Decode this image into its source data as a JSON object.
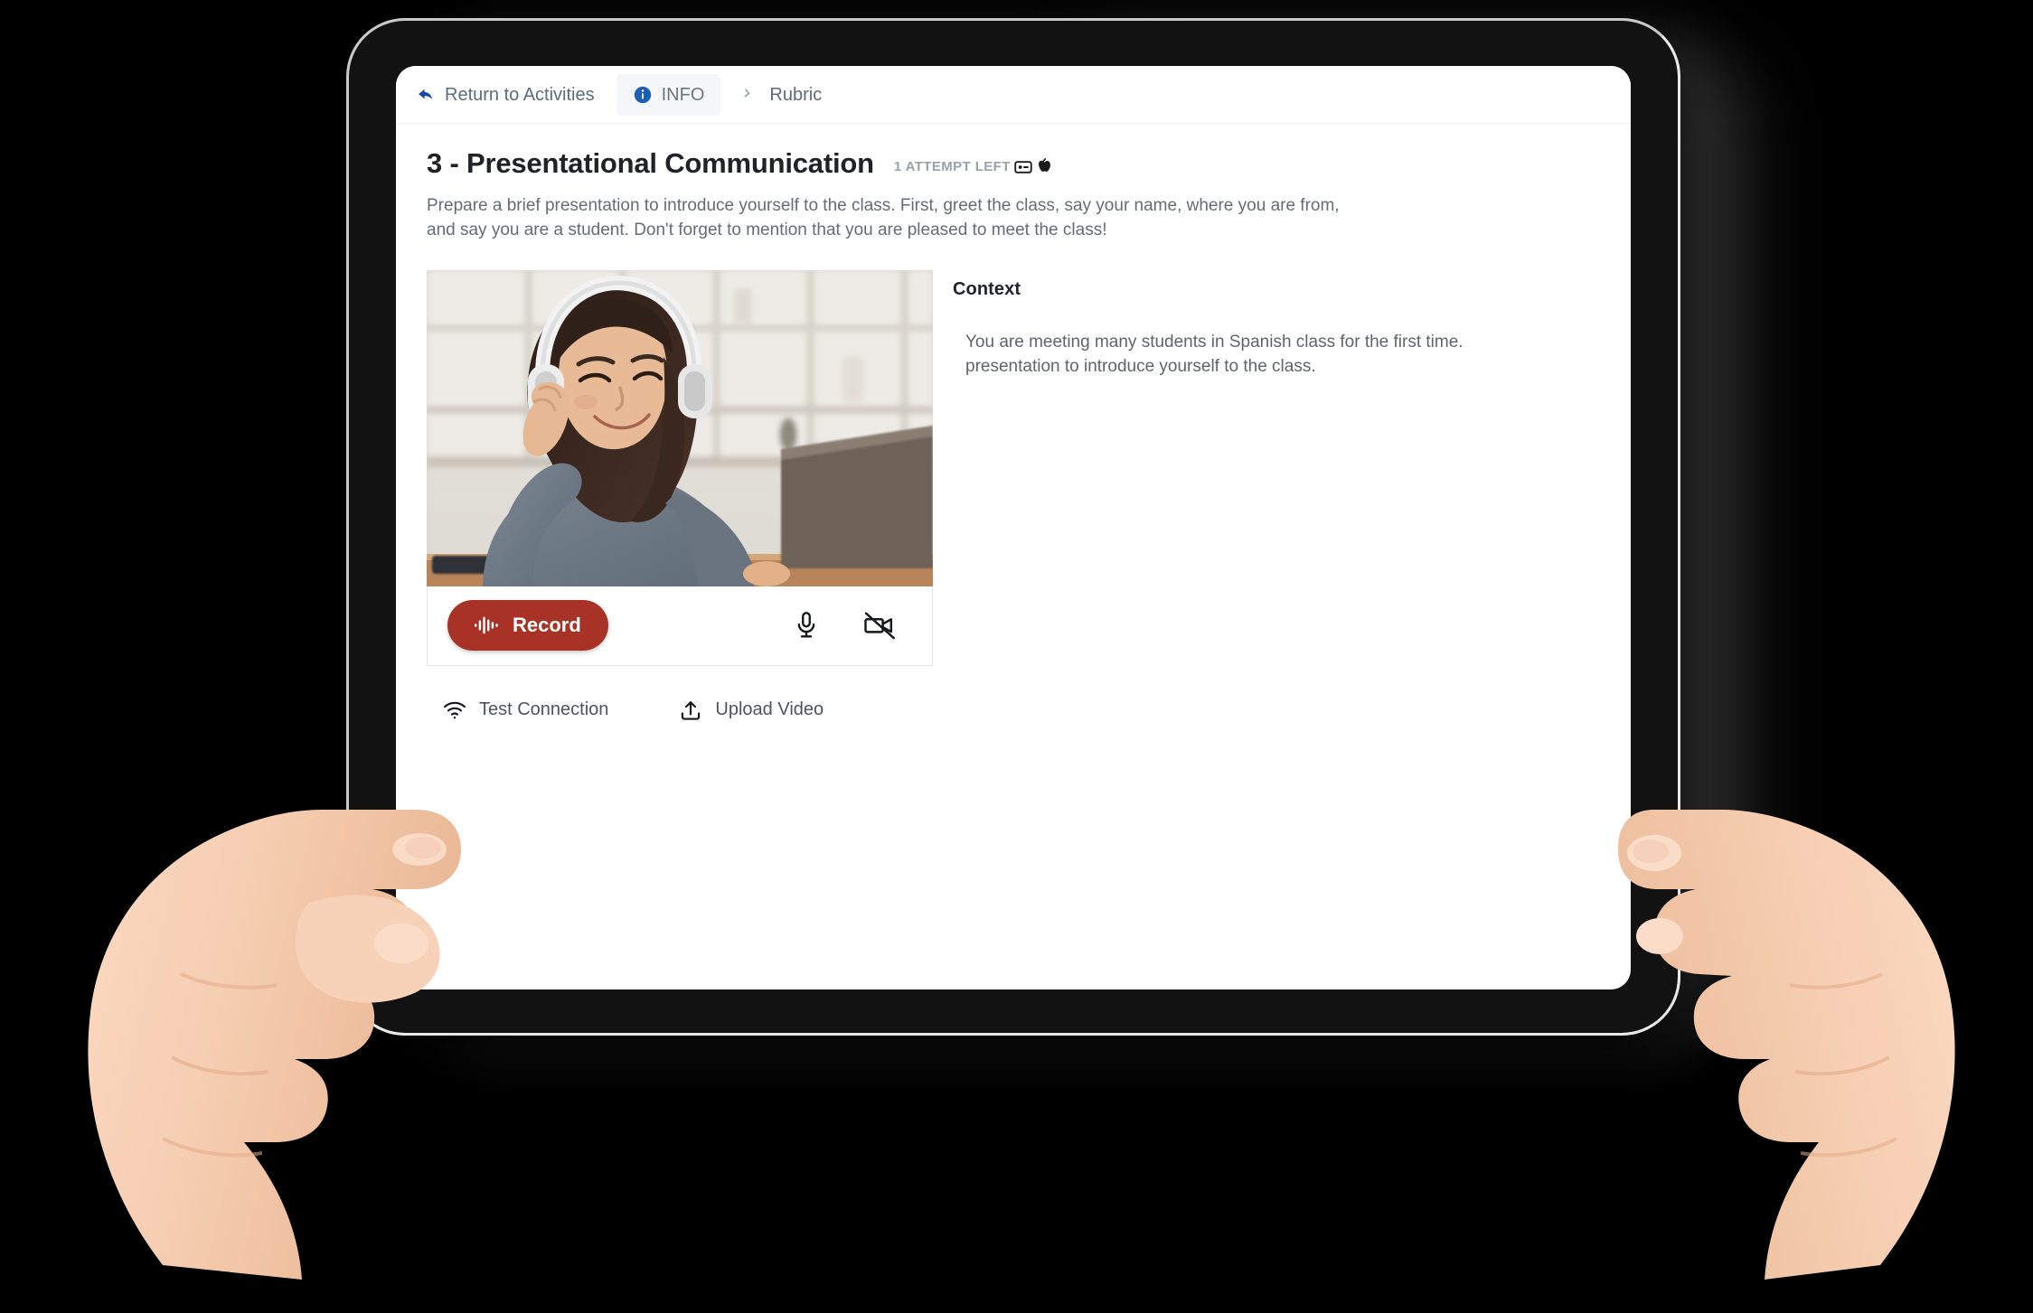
{
  "device": {
    "kind": "tablet",
    "frame_color": "#121212",
    "rim_color": "#c9c9c9",
    "screen_background": "#ffffff"
  },
  "tabbar": {
    "return": {
      "label": "Return to Activities",
      "icon": "back-arrow-icon",
      "icon_color": "#17479e"
    },
    "tabs": [
      {
        "label": "INFO",
        "icon": "info-circle-icon",
        "icon_color": "#1a5fb4",
        "active": true
      },
      {
        "label": "Rubric",
        "icon": "rubric-check-icon",
        "icon_color": "#9aa3ab",
        "active": false
      }
    ]
  },
  "activity": {
    "title": "3 - Presentational Communication",
    "attempts_label": "1 ATTEMPT LEFT",
    "badges": [
      {
        "name": "speaking-badge-icon"
      },
      {
        "name": "apple-badge-icon"
      }
    ],
    "instructions": "Prepare a brief presentation to introduce yourself to the class. First, greet the class, say your name, where you are from, and say you are a student. Don't forget to mention that you are pleased to meet the class!"
  },
  "recorder": {
    "thumbnail_alt": "Smiling woman wearing white headphones at a laptop in front of a bookshelf",
    "record_label": "Record",
    "record_color": "#a93226",
    "record_icon": "waveform-icon",
    "mic_icon": "microphone-icon",
    "camera_icon": "video-camera-off-icon"
  },
  "bottom_links": [
    {
      "label": "Test Connection",
      "icon": "wifi-icon"
    },
    {
      "label": "Upload Video",
      "icon": "upload-icon"
    }
  ],
  "context": {
    "heading": "Context",
    "text": "You are meeting many students in Spanish class for the first time.\npresentation to introduce yourself to the class."
  }
}
